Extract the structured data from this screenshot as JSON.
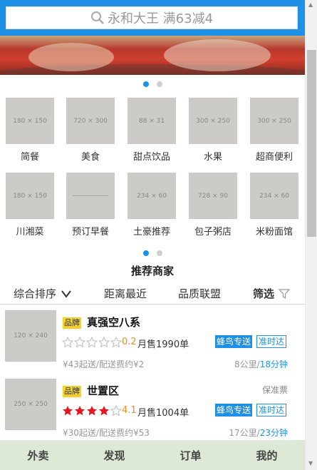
{
  "search": {
    "placeholder": "永和大王 满63减4",
    "icon": "search-icon"
  },
  "categories": [
    {
      "label": "简餐",
      "img": "180 × 150"
    },
    {
      "label": "美食",
      "img": "720 × 300"
    },
    {
      "label": "甜点饮品",
      "img": "88 × 31"
    },
    {
      "label": "水果",
      "img": "300 × 250"
    },
    {
      "label": "超商便利",
      "img": "300 × 250"
    },
    {
      "label": "川湘菜",
      "img": "180 × 150"
    },
    {
      "label": "预订早餐",
      "img": ""
    },
    {
      "label": "土豪推荐",
      "img": "234 × 60"
    },
    {
      "label": "包子粥店",
      "img": "728 × 90"
    },
    {
      "label": "米粉面馆",
      "img": "234 × 60"
    }
  ],
  "section_title": "推荐商家",
  "sort": {
    "comprehensive": "综合排序",
    "nearest": "距离最近",
    "quality": "品质联盟",
    "filter": "筛选"
  },
  "shops": [
    {
      "img": "120 × 240",
      "brand": "品牌",
      "name": "真强空八系",
      "stars": 0,
      "rating": "0.2",
      "sold": "月售1990单",
      "tag_blue": "蜂鸟专送",
      "tag_outline": "准时达",
      "fees": "¥43起送/配送费约¥2",
      "distance": "8公里",
      "time": "18分钟",
      "invoice": ""
    },
    {
      "img": "250 × 250",
      "brand": "品牌",
      "name": "世置区",
      "stars": 4,
      "rating": "4.1",
      "sold": "月售1004单",
      "tag_blue": "蜂鸟专送",
      "tag_outline": "准时达",
      "fees": "¥30起送/配送费约¥53",
      "distance": "17公里",
      "time": "23分钟",
      "invoice": "保准票"
    }
  ],
  "bottom_nav": [
    "外卖",
    "发现",
    "订单",
    "我的"
  ],
  "colors": {
    "accent": "#1e90e6",
    "star": "#e8131c",
    "rating": "#f08a1c",
    "brand_badge": "#f6d02b",
    "bottom_nav_bg": "#dde9d6"
  }
}
